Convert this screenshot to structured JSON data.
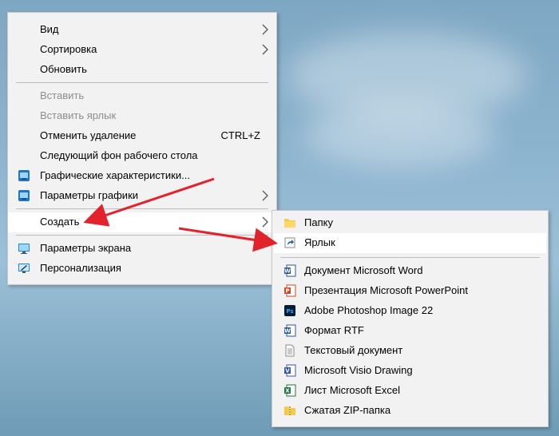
{
  "context_menu": {
    "items": [
      {
        "label": "Вид"
      },
      {
        "label": "Сортировка"
      },
      {
        "label": "Обновить"
      },
      {
        "label": "Вставить"
      },
      {
        "label": "Вставить ярлык"
      },
      {
        "label": "Отменить удаление",
        "shortcut": "CTRL+Z"
      },
      {
        "label": "Следующий фон рабочего стола"
      },
      {
        "label": "Графические характеристики...",
        "icon": "intel-graphics-icon"
      },
      {
        "label": "Параметры графики",
        "icon": "intel-graphics-icon"
      },
      {
        "label": "Создать"
      },
      {
        "label": "Параметры экрана",
        "icon": "display-settings-icon"
      },
      {
        "label": "Персонализация",
        "icon": "personalize-icon"
      }
    ]
  },
  "submenu": {
    "items": [
      {
        "label": "Папку",
        "icon": "folder-icon"
      },
      {
        "label": "Ярлык",
        "icon": "shortcut-icon"
      },
      {
        "label": "Документ Microsoft Word",
        "icon": "word-icon"
      },
      {
        "label": "Презентация Microsoft PowerPoint",
        "icon": "powerpoint-icon"
      },
      {
        "label": "Adobe Photoshop Image 22",
        "icon": "photoshop-icon"
      },
      {
        "label": "Формат RTF",
        "icon": "rtf-icon"
      },
      {
        "label": "Текстовый документ",
        "icon": "text-document-icon"
      },
      {
        "label": "Microsoft Visio Drawing",
        "icon": "visio-icon"
      },
      {
        "label": "Лист Microsoft Excel",
        "icon": "excel-icon"
      },
      {
        "label": "Сжатая ZIP-папка",
        "icon": "zip-folder-icon"
      }
    ]
  },
  "colors": {
    "arrow": "#e3232c",
    "menu_bg": "#f2f2f2",
    "hover_bg": "#ffffff"
  }
}
